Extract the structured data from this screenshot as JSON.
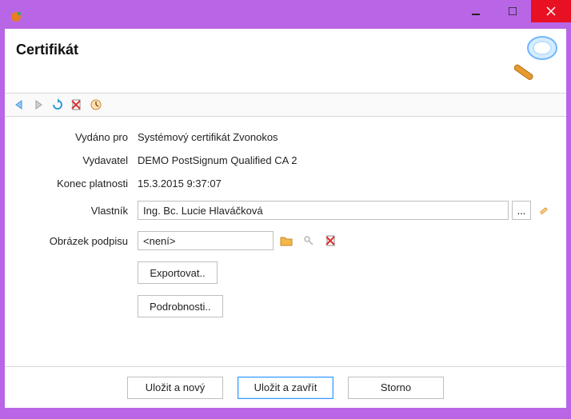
{
  "window": {
    "title": ""
  },
  "header": {
    "title": "Certifikát"
  },
  "toolbar": {
    "items": [
      "nav-back",
      "nav-forward",
      "refresh",
      "delete",
      "history"
    ]
  },
  "form": {
    "issued_to_label": "Vydáno pro",
    "issued_to_value": "Systémový certifikát Zvonokos",
    "issuer_label": "Vydavatel",
    "issuer_value": "DEMO PostSignum Qualified CA 2",
    "expiry_label": "Konec platnosti",
    "expiry_value": "15.3.2015 9:37:07",
    "owner_label": "Vlastník",
    "owner_value": "Ing. Bc. Lucie Hlaváčková",
    "owner_browse": "...",
    "signature_label": "Obrázek podpisu",
    "signature_value": "<není>",
    "export_label": "Exportovat..",
    "details_label": "Podrobnosti.."
  },
  "footer": {
    "save_new": "Uložit a nový",
    "save_close": "Uložit a zavřít",
    "cancel": "Storno"
  }
}
